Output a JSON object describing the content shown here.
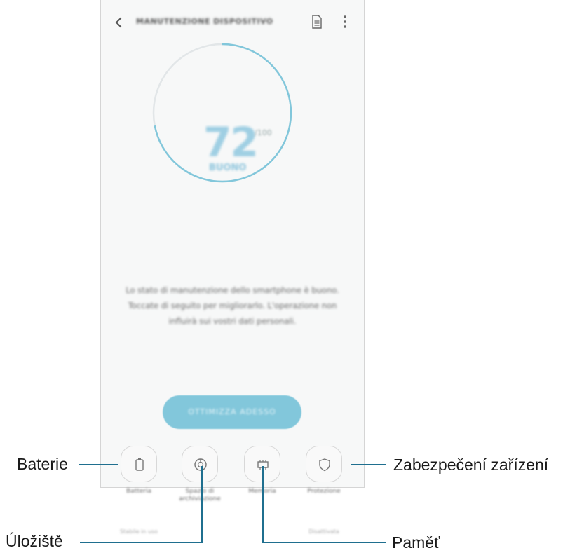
{
  "app": {
    "title": "MANUTENZIONE DISPOSITIVO",
    "score": "72",
    "score_unit": "/100",
    "status": "BUONO",
    "description": "Lo stato di manutenzione dello smartphone è buono. Toccate di seguito per migliorarlo. L'operazione non influirà sui vostri dati personali.",
    "optimize_label": "OTTIMIZZA ADESSO",
    "gauge_fraction": 0.72,
    "accent_color": "#82c7db",
    "tiles": [
      {
        "label": "Batteria",
        "sub": "Stabile in uso",
        "icon": "battery-icon"
      },
      {
        "label": "Spazio di archiviazione",
        "sub": "",
        "icon": "storage-icon"
      },
      {
        "label": "Memoria",
        "sub": "",
        "icon": "memory-icon"
      },
      {
        "label": "Protezione",
        "sub": "Disattivata",
        "icon": "shield-icon"
      }
    ]
  },
  "callouts": {
    "battery": "Baterie",
    "storage": "Úložiště",
    "memory": "Paměť",
    "security": "Zabezpečení zařízení"
  },
  "line_color": "#1f6f8f"
}
